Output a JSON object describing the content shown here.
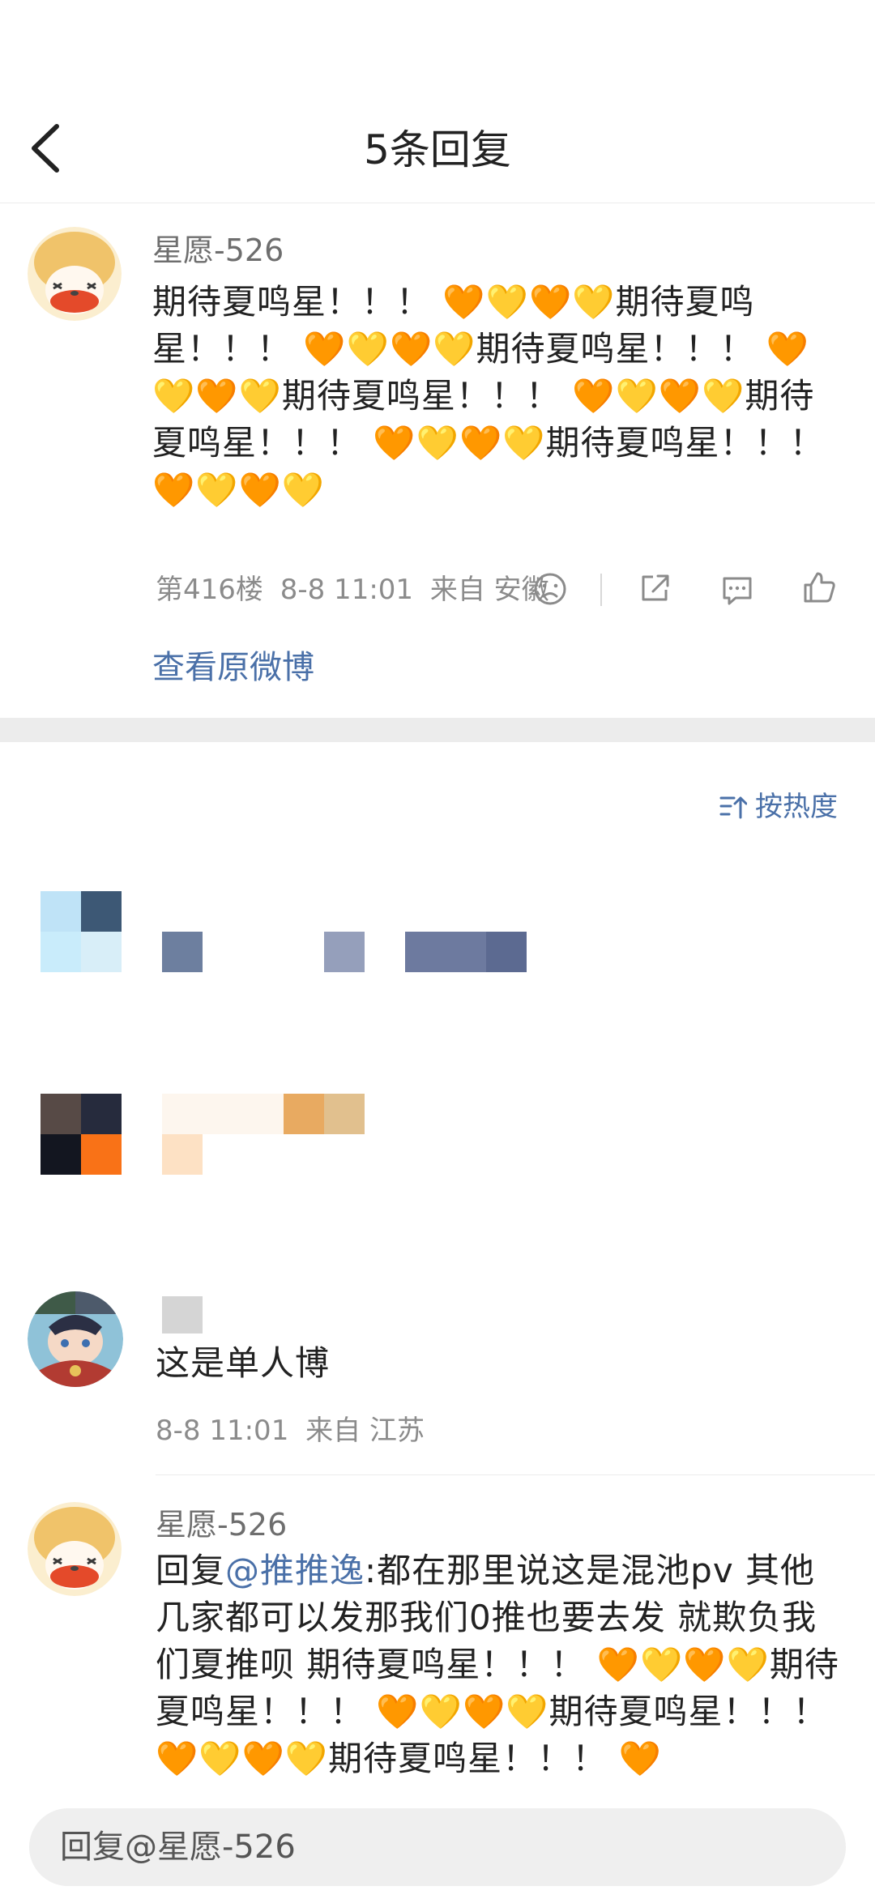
{
  "header": {
    "title": "5条回复"
  },
  "root_comment": {
    "username": "星愿-526",
    "text": "期待夏鸣星！！！ 🧡💛🧡💛期待夏鸣星！！！ 🧡💛🧡💛期待夏鸣星！！！ 🧡💛🧡💛期待夏鸣星！！！ 🧡💛🧡💛期待夏鸣星！！！ 🧡💛🧡💛期待夏鸣星！！！ 🧡💛🧡💛",
    "floor": "第416楼",
    "time": "8-8 11:01",
    "location": "来自 安徽",
    "view_original": "查看原微博"
  },
  "sort": {
    "label": "按热度"
  },
  "replies": [
    {
      "username": "",
      "text": "这是单人博",
      "time": "8-8 11:01",
      "location": "来自 江苏"
    },
    {
      "username": "星愿-526",
      "prefix": "回复",
      "mention": "@推推逸",
      "text": ":都在那里说这是混池pv 其他几家都可以发那我们0推也要去发 就欺负我们夏推呗 期待夏鸣星！！！ 🧡💛🧡💛期待夏鸣星！！！ 🧡💛🧡💛期待夏鸣星！！！ 🧡💛🧡💛期待夏鸣星！！！ 🧡"
    }
  ],
  "reply_input": {
    "placeholder": "回复@星愿-526"
  },
  "icons": [
    "back-chevron-icon",
    "sad-face-icon",
    "share-icon",
    "comment-icon",
    "like-icon",
    "sort-icon"
  ],
  "colors": {
    "link": "#4a70a8",
    "meta": "#8b8b8b",
    "separator": "#ececec"
  }
}
